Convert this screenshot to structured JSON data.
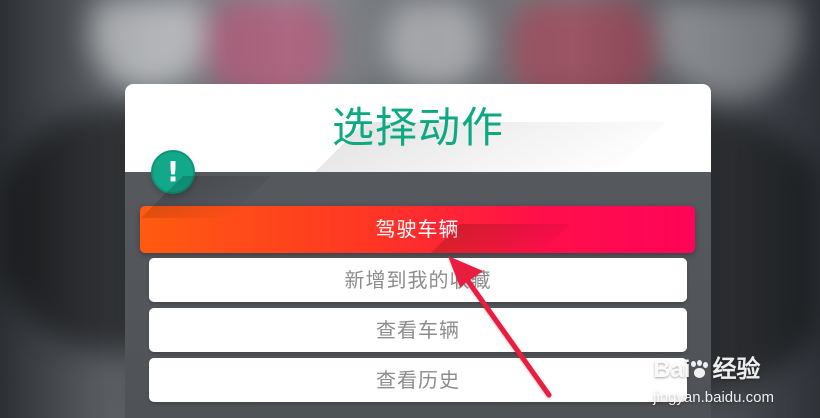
{
  "dialog": {
    "title": "选择动作",
    "actions": [
      {
        "label": "驾驶车辆",
        "active": true
      },
      {
        "label": "新增到我的收藏",
        "active": false
      },
      {
        "label": "查看车辆",
        "active": false
      },
      {
        "label": "查看历史",
        "active": false
      }
    ],
    "alert_icon": "!"
  },
  "annotation": {
    "arrow_icon": "red-arrow-icon"
  },
  "watermark": {
    "brand_left": "Bai",
    "brand_right": "经验",
    "logo_icon": "paw-icon",
    "url": "jingyan.baidu.com"
  },
  "colors": {
    "title": "#0ca982",
    "primary_start": "#ff5b10",
    "primary_end": "#ff0458",
    "alert": "#12a98a",
    "arrow": "#ea1c3f"
  }
}
